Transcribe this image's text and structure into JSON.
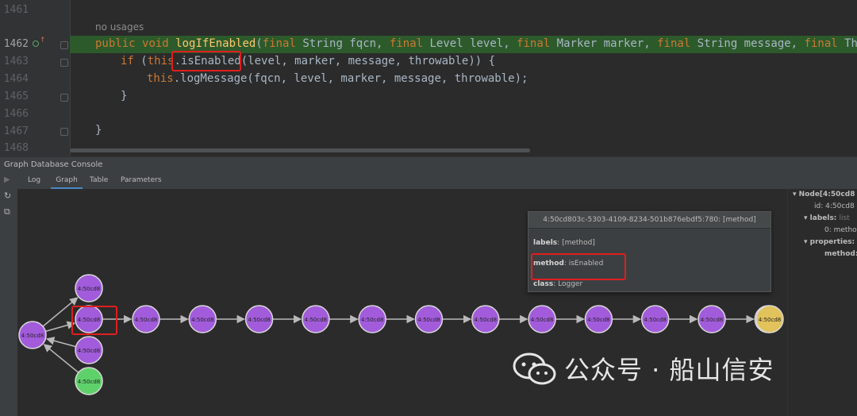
{
  "editor": {
    "line_numbers": [
      "1461",
      "1462",
      "1463",
      "1464",
      "1465",
      "1466",
      "1467",
      "1468"
    ],
    "hint": "no usages",
    "line1462": {
      "public": "public ",
      "void": "void ",
      "fn": "logIfEnabled",
      "rest": "(",
      "final1": "final ",
      "p1": "String fqcn, ",
      "final2": "final ",
      "p2": "Level level, ",
      "final3": "final ",
      "p3": "Marker marker, ",
      "final4": "final ",
      "p4": "String message, ",
      "final5": "final ",
      "p5": "Throwab"
    },
    "line1463": {
      "if": "if ",
      "open": "(",
      "this": "this",
      "call": ".isEnabled",
      "args": "(level, marker, message, throwable)) {"
    },
    "line1464": {
      "this": "this",
      "call": ".logMessage(fqcn, level, marker, message, throwable);"
    },
    "line1465": "}",
    "line1467": "}"
  },
  "console": {
    "title": "Graph Database Console",
    "tabs": [
      "Log",
      "Graph",
      "Table",
      "Parameters"
    ],
    "active_tab": "Graph"
  },
  "graph": {
    "node_label": "4:50cd8",
    "colors": {
      "method": "#a25cdb",
      "start": "#5fd16b",
      "end": "#e2c25a",
      "edge": "#b9b9b9"
    },
    "tooltip": {
      "header": "4:50cd803c-5303-4109-8234-501b876ebdf5:780: [method]",
      "labels_key": "labels",
      "labels_val": "[method]",
      "method_key": "method",
      "method_val": "isEnabled",
      "class_key": "class",
      "class_val": "Logger"
    }
  },
  "inspector": {
    "node": "Node[4:50cd8",
    "id": "id: 4:50cd8",
    "labels": "labels:",
    "labels_hint": "list",
    "labels_0": "0: metho",
    "properties": "properties:",
    "method": "method:"
  },
  "watermark": {
    "text": "公众号 · 船山信安"
  }
}
